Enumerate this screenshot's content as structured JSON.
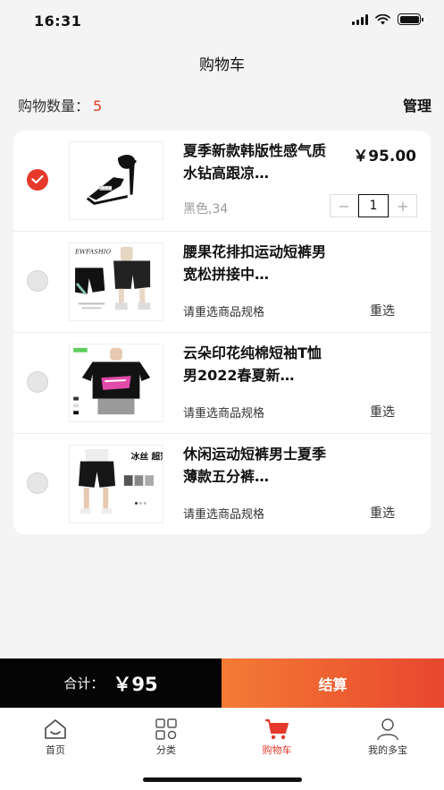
{
  "status_bar": {
    "time": "16:31"
  },
  "header": {
    "title": "购物车"
  },
  "summary": {
    "label": "购物数量：",
    "count": "5",
    "manage": "管理"
  },
  "cart": {
    "items": [
      {
        "title": "夏季新款韩版性感气质水钻高跟凉…",
        "price": "￥95.00",
        "variant": "黑色,34",
        "quantity": "1",
        "selected": true
      },
      {
        "title": "腰果花排扣运动短裤男宽松拼接中…",
        "prompt": "请重选商品规格",
        "action": "重选",
        "selected": false,
        "thumb_text": "EWFASHIO"
      },
      {
        "title": "云朵印花纯棉短袖T恤男2022春夏新…",
        "prompt": "请重选商品规格",
        "action": "重选",
        "selected": false
      },
      {
        "title": "休闲运动短裤男士夏季薄款五分裤…",
        "prompt": "请重选商品规格",
        "action": "重选",
        "selected": false,
        "thumb_text": "冰丝 超薄"
      }
    ]
  },
  "checkout": {
    "total_label": "合计：",
    "total_value": "￥95",
    "button": "结算"
  },
  "tabbar": {
    "tabs": [
      {
        "label": "首页",
        "icon": "home-icon"
      },
      {
        "label": "分类",
        "icon": "category-grid-icon"
      },
      {
        "label": "购物车",
        "icon": "cart-icon",
        "active": true
      },
      {
        "label": "我的多宝",
        "icon": "profile-icon"
      }
    ]
  },
  "colors": {
    "accent": "#e53a2b",
    "checkout_gradient_start": "#f47b35",
    "checkout_gradient_end": "#e8462e",
    "total_bar": "#050505"
  }
}
